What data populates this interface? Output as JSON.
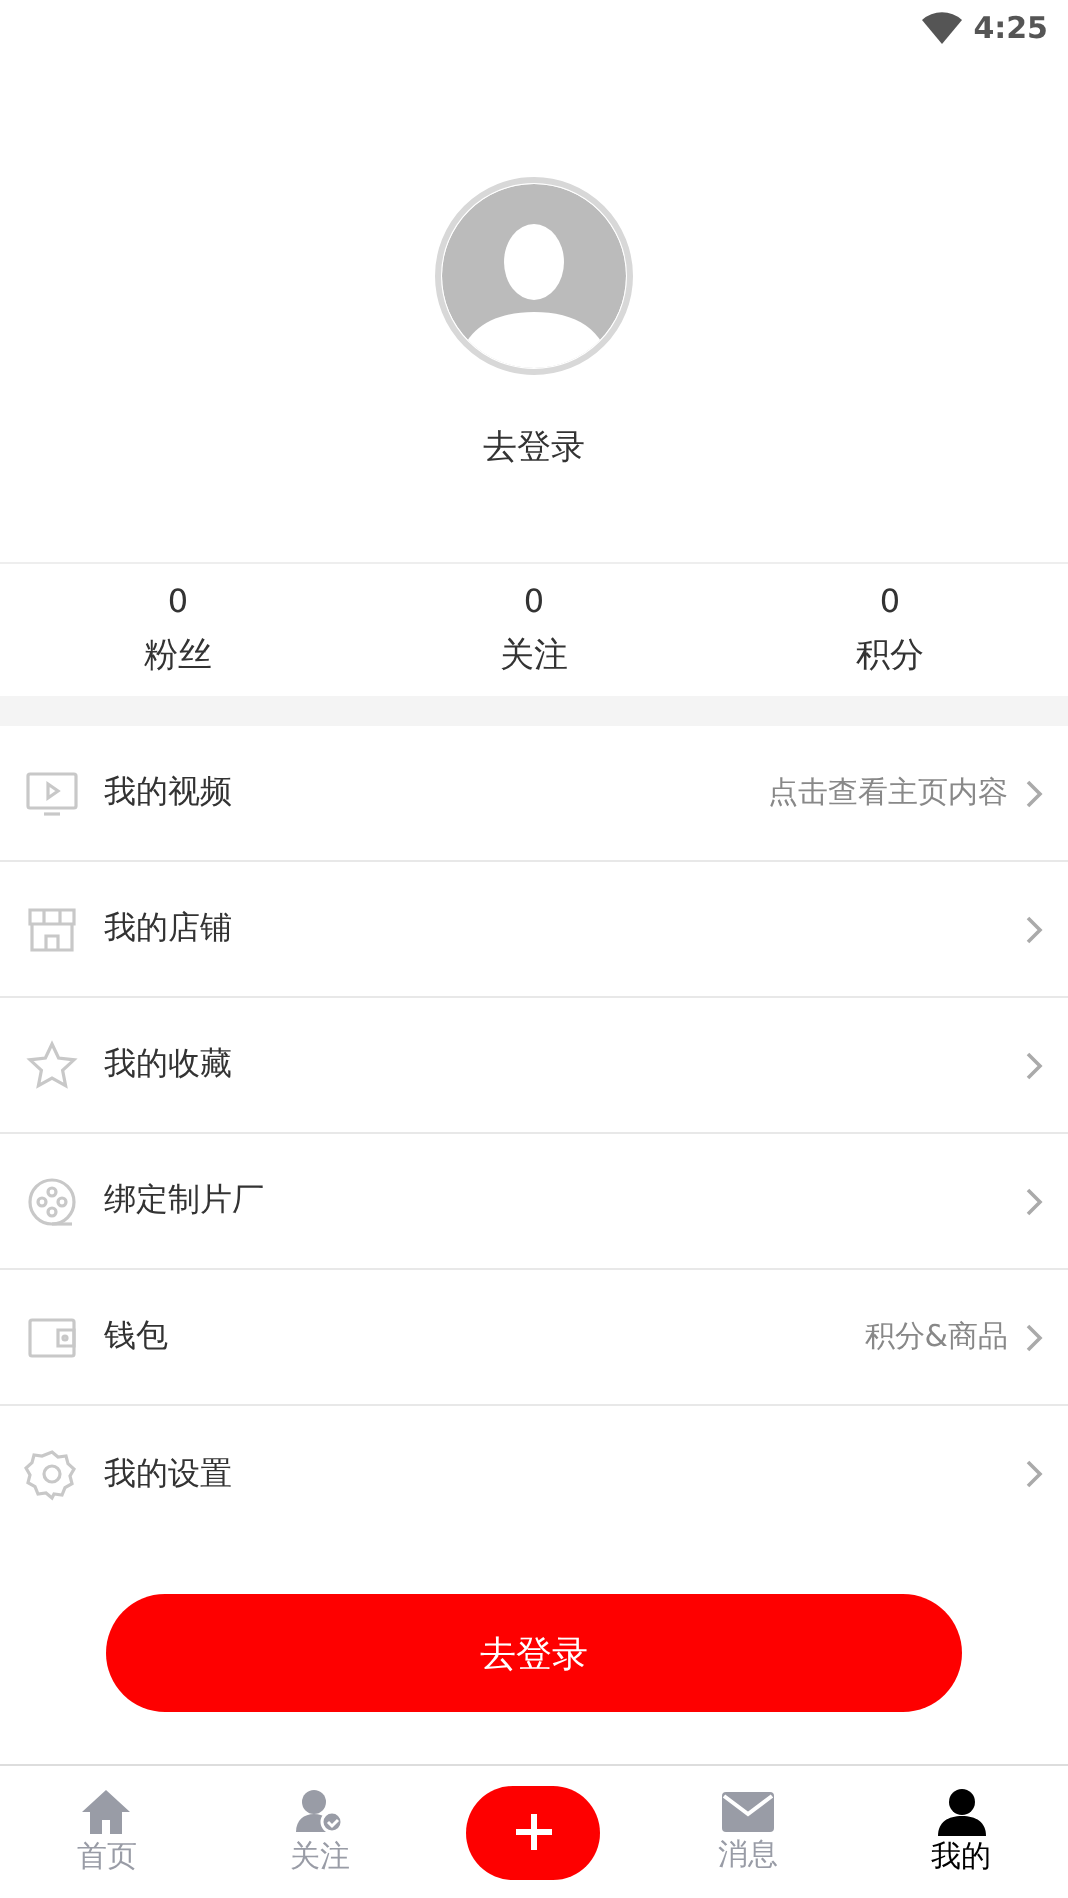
{
  "status_bar": {
    "time": "4:25"
  },
  "profile": {
    "login_text": "去登录"
  },
  "stats": [
    {
      "value": "0",
      "label": "粉丝"
    },
    {
      "value": "0",
      "label": "关注"
    },
    {
      "value": "0",
      "label": "积分"
    }
  ],
  "menu": [
    {
      "label": "我的视频",
      "hint": "点击查看主页内容"
    },
    {
      "label": "我的店铺"
    },
    {
      "label": "我的收藏"
    },
    {
      "label": "绑定制片厂"
    },
    {
      "label": "钱包",
      "hint": "积分&商品"
    },
    {
      "label": "我的设置"
    }
  ],
  "login_button": "去登录",
  "tabs": [
    {
      "kind": "home",
      "label": "首页",
      "selected": false
    },
    {
      "kind": "follow",
      "label": "关注",
      "selected": false
    },
    {
      "kind": "add",
      "selected": false
    },
    {
      "kind": "message",
      "label": "消息",
      "selected": false
    },
    {
      "kind": "me",
      "label": "我的",
      "selected": true
    }
  ]
}
